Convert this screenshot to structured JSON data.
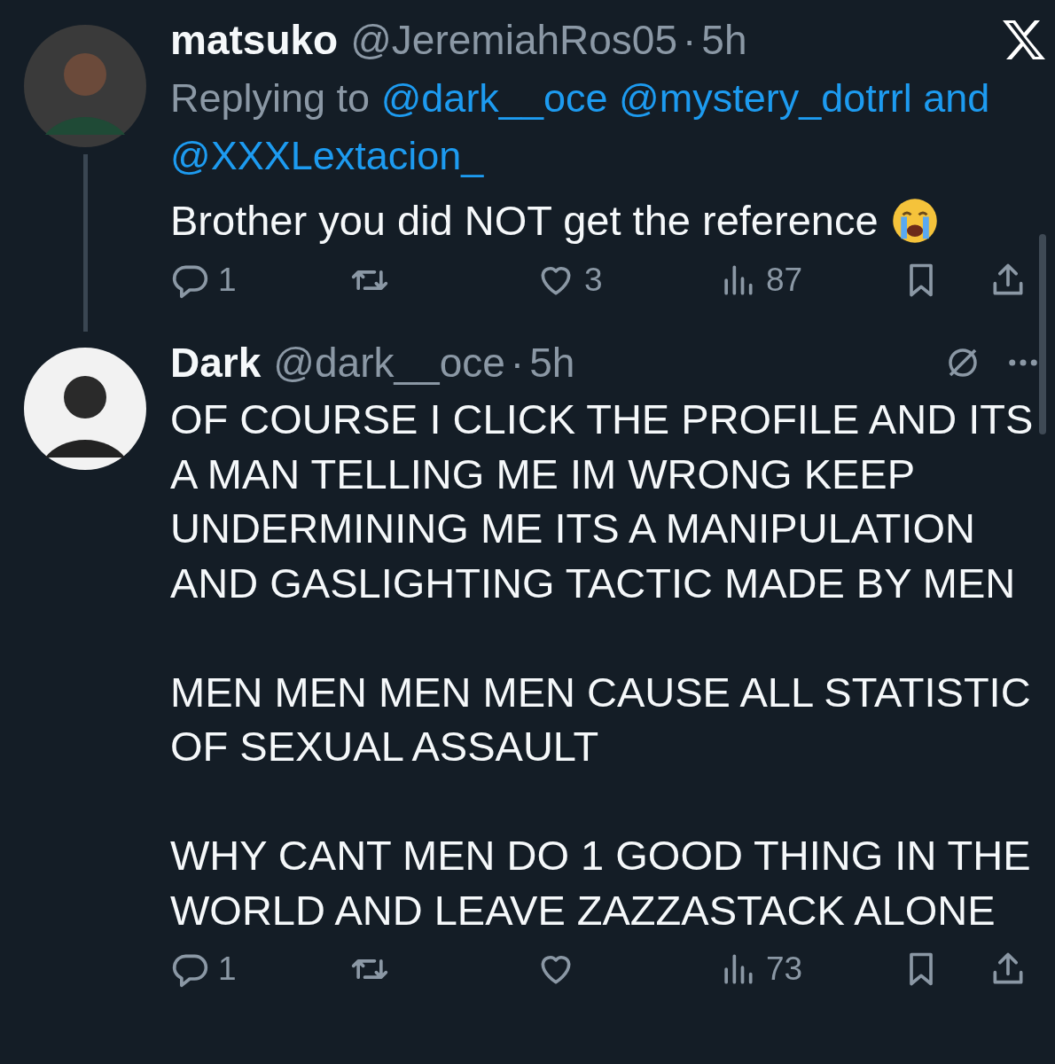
{
  "tweets": [
    {
      "name": "matsuko",
      "handle": "@JeremiahRos05",
      "dot": "·",
      "time": "5h",
      "header_icons": [
        {
          "kind": "x_logo"
        }
      ],
      "thread_line": true,
      "reply_to": {
        "prefix": "Replying to",
        "mentions": [
          "@dark__oce",
          "@mystery_dotrrl"
        ],
        "joiner": "and",
        "last": "@XXXLextacion_"
      },
      "paragraphs": [
        "Brother you did NOT get the reference"
      ],
      "emoji": {
        "kind": "crying"
      },
      "actions": {
        "replies": "1",
        "likes": "3",
        "views": "87"
      }
    },
    {
      "name": "Dark",
      "handle": "@dark__oce",
      "dot": "·",
      "time": "5h",
      "header_icons": [
        {
          "kind": "mute"
        },
        {
          "kind": "more"
        }
      ],
      "thread_line": false,
      "paragraphs": [
        "OF COURSE I CLICK THE PROFILE AND ITS A MAN TELLING ME IM WRONG KEEP UNDERMINING ME ITS A MANIPULATION AND GASLIGHTING TACTIC MADE BY MEN",
        "MEN MEN MEN MEN CAUSE ALL STATISTIC OF SEXUAL ASSAULT",
        "WHY CANT MEN DO 1 GOOD THING IN THE WORLD AND LEAVE ZAZZASTACK ALONE"
      ],
      "actions": {
        "replies": "1",
        "views": "73"
      }
    }
  ]
}
